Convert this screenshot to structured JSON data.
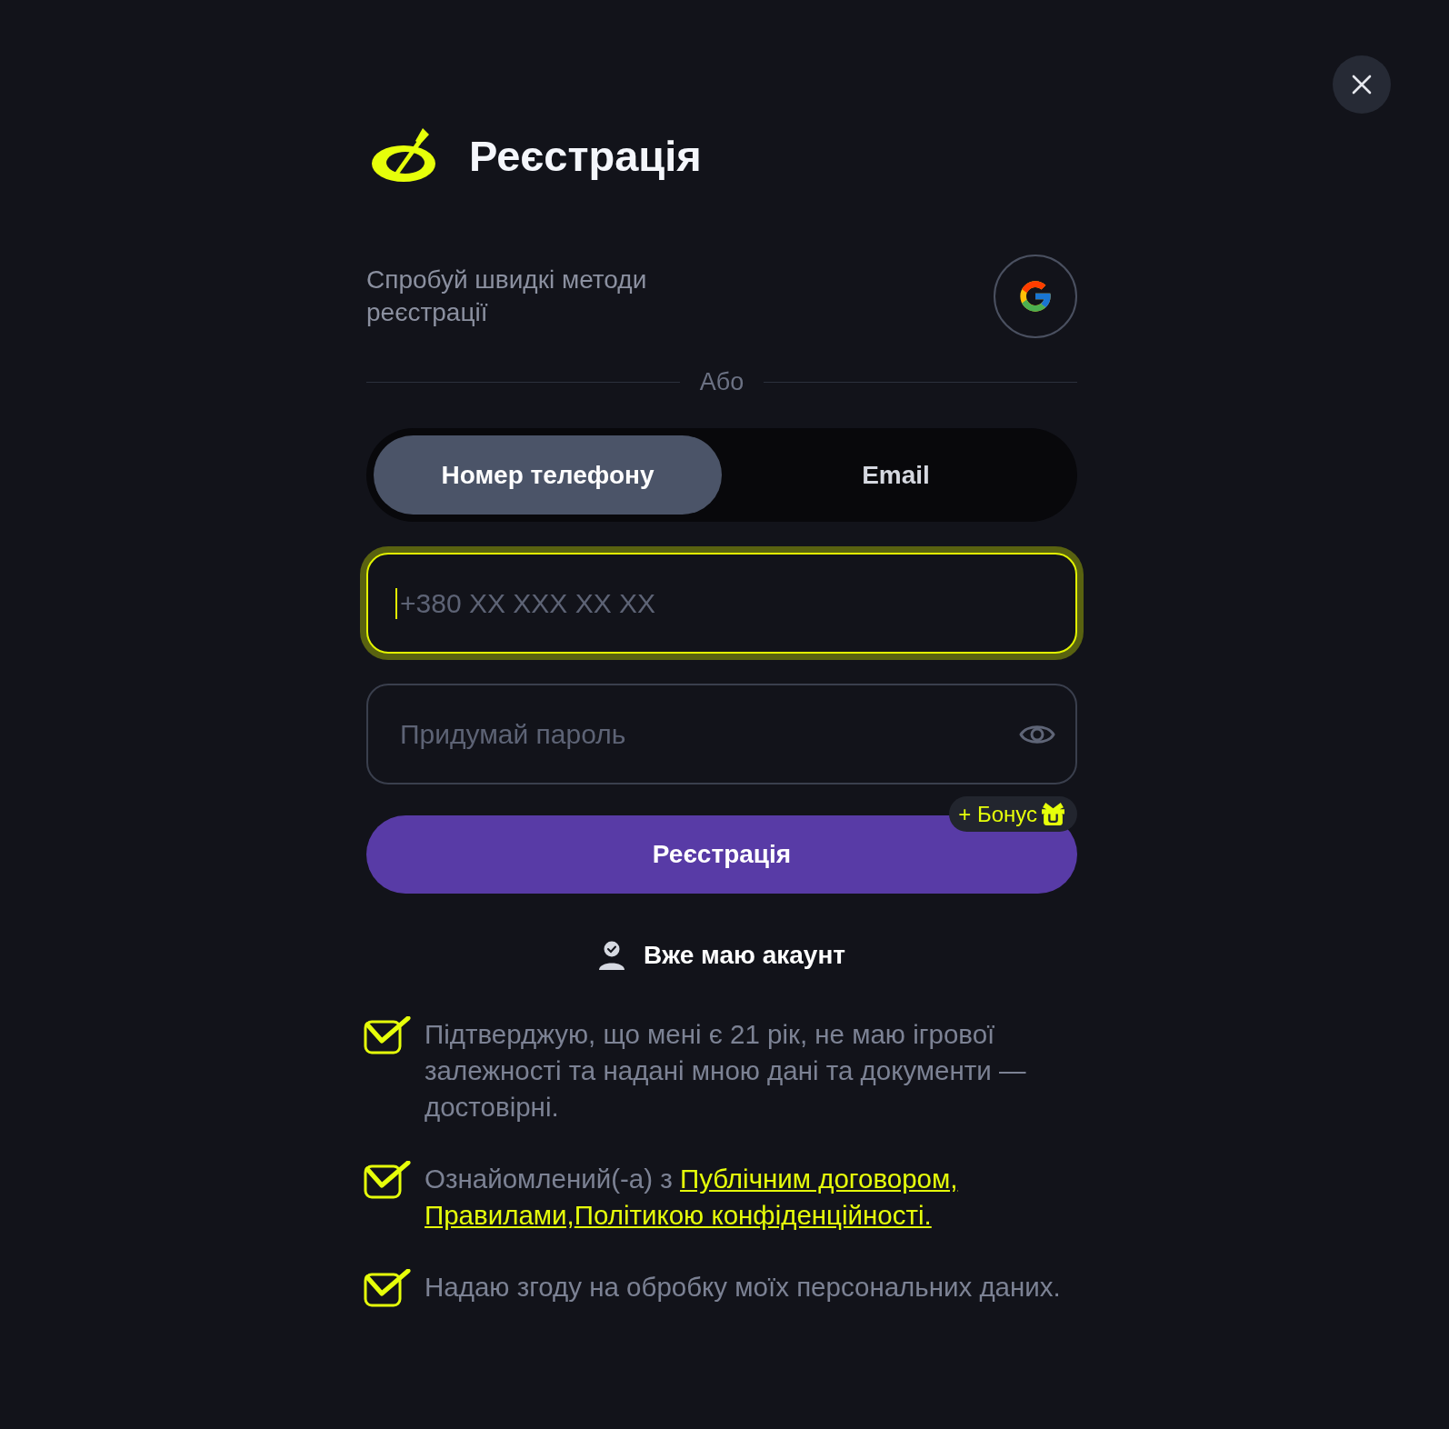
{
  "header": {
    "title": "Реєстрація"
  },
  "quick_signup": {
    "text": "Спробуй швидкі методи реєстрації"
  },
  "divider": {
    "label": "Або"
  },
  "tabs": [
    {
      "label": "Номер телефону",
      "selected": true
    },
    {
      "label": "Email",
      "selected": false
    }
  ],
  "fields": [
    {
      "kind": "phone",
      "placeholder": "+380 XX XXX XX XX",
      "focused": true
    },
    {
      "kind": "password",
      "placeholder": "Придумай пароль",
      "focused": false
    }
  ],
  "register_button": {
    "label": "Реєстрація",
    "badge": "+ Бонус"
  },
  "login_link": {
    "label": "Вже маю акаунт"
  },
  "consents": [
    {
      "checked": true,
      "text": "Підтверджую, що мені є 21 рік, не маю ігрової залежності та надані мною дані та документи — достовірні."
    },
    {
      "checked": true,
      "text": "Ознайомлений(-а) з",
      "links": [
        "Публічним договором,",
        "Правилами,",
        "Політикою конфіденційності."
      ]
    },
    {
      "checked": true,
      "text": "Надаю згоду на обробку моїх персональних даних."
    }
  ]
}
